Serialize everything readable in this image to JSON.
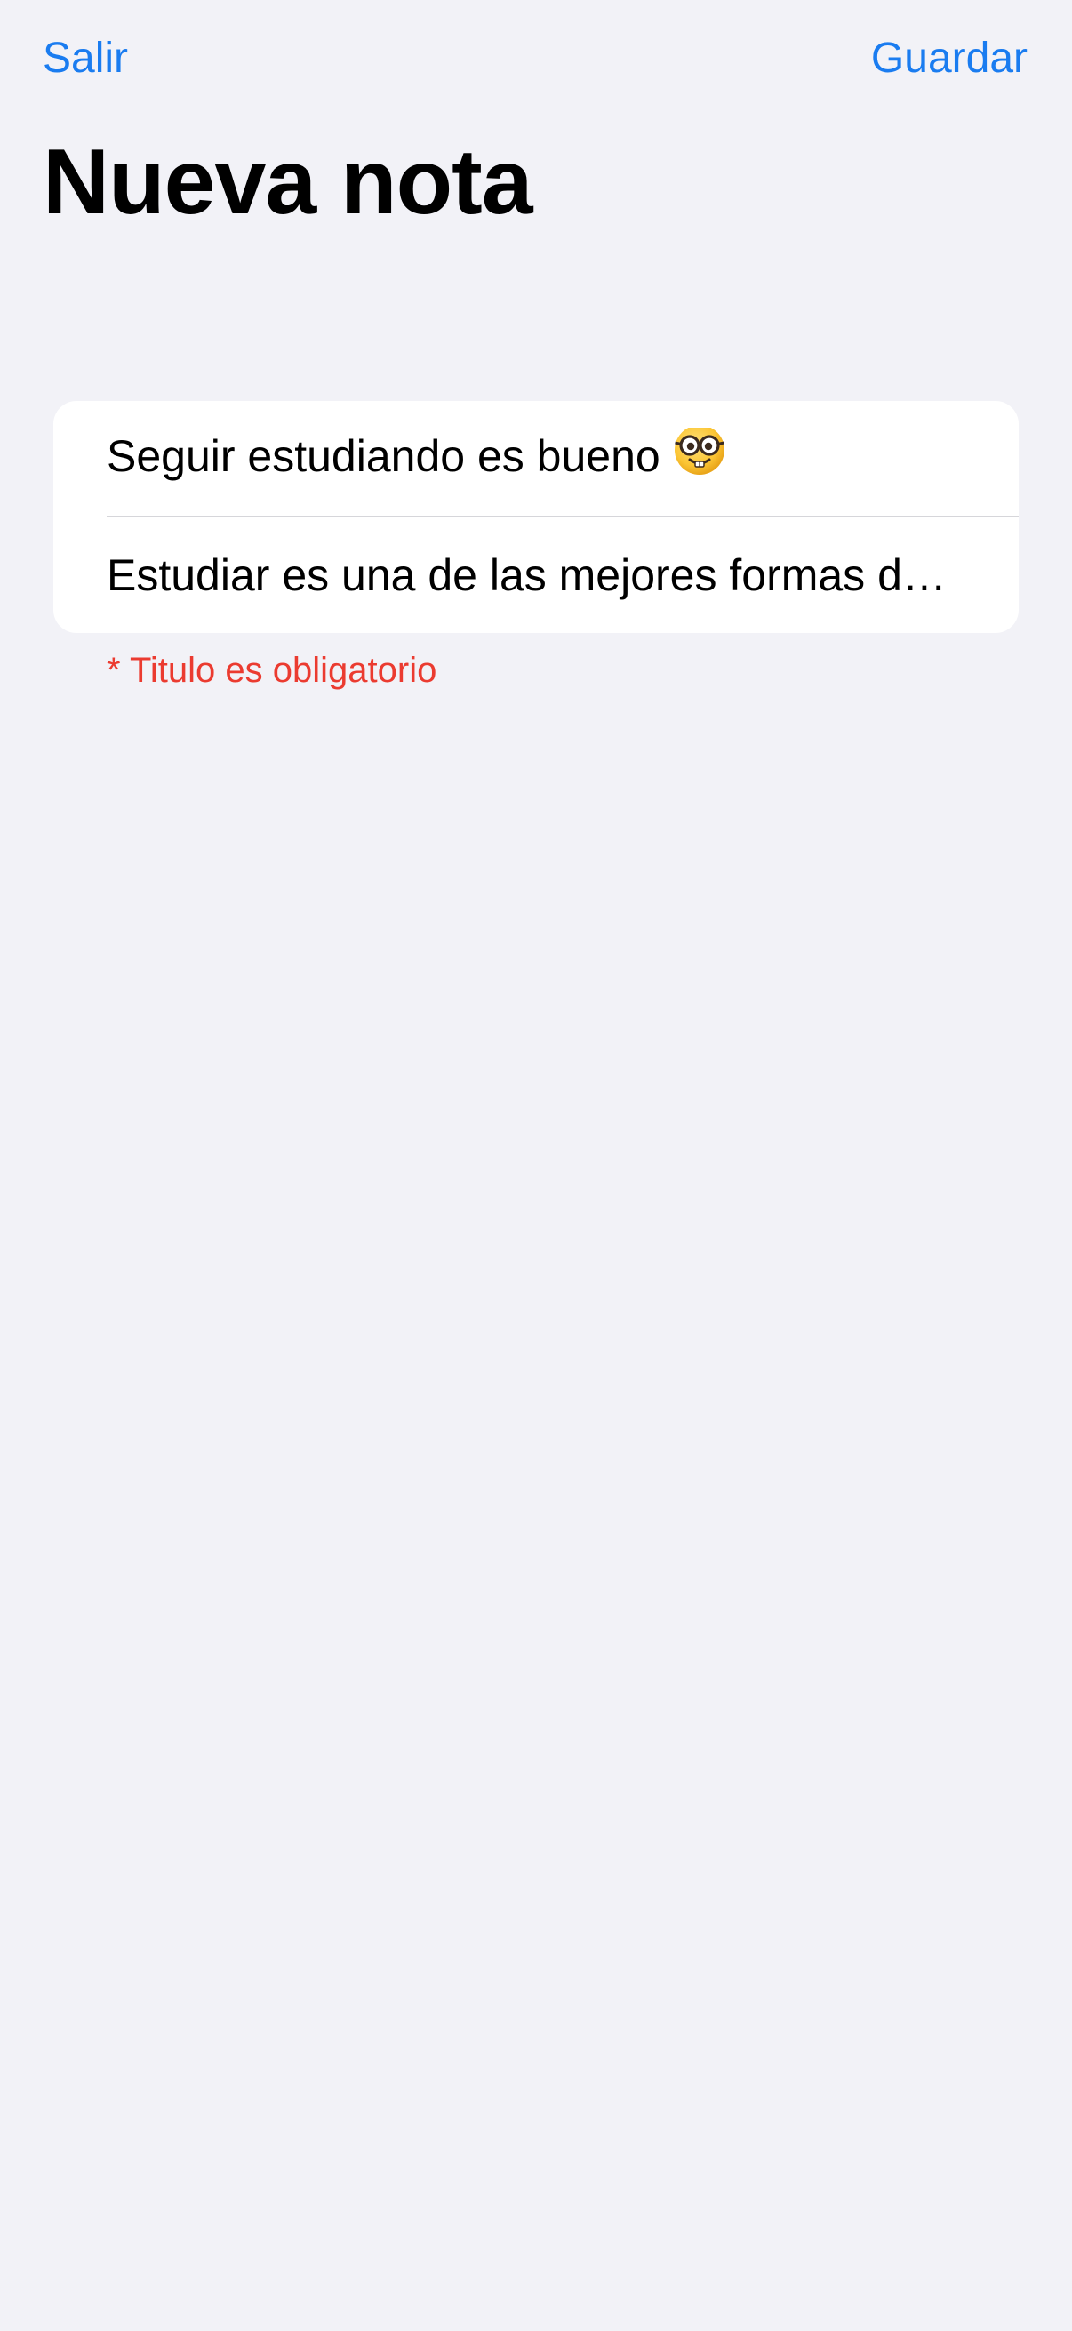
{
  "nav": {
    "left_label": "Salir",
    "right_label": "Guardar"
  },
  "page": {
    "title": "Nueva nota"
  },
  "form": {
    "title_value": "Seguir estudiando es bueno",
    "title_emoji": "nerd-face-icon",
    "body_value": "Estudiar es una de las mejores formas de aprender",
    "error_text": "* Titulo es obligatorio"
  },
  "colors": {
    "accent": "#1a7cf0",
    "background": "#f2f2f7",
    "error": "#eb3b30",
    "field_background": "#ffffff"
  }
}
